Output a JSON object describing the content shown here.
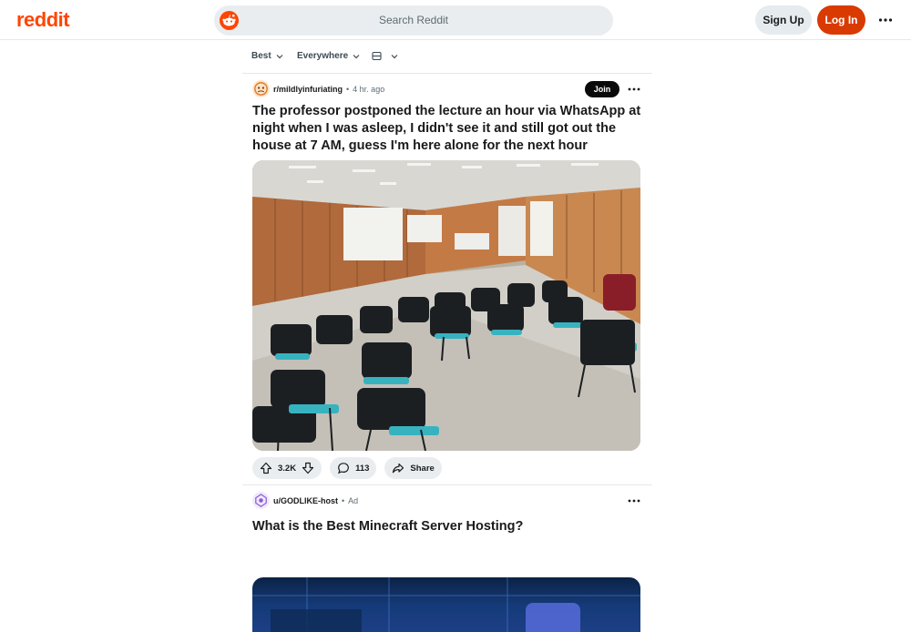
{
  "header": {
    "logo_text": "reddit",
    "search_placeholder": "Search Reddit",
    "signup_label": "Sign Up",
    "login_label": "Log In",
    "brand_color": "#ff4500",
    "login_color": "#d93a00"
  },
  "sortbar": {
    "sort": "Best",
    "location": "Everywhere",
    "view_icon": "layout-view-icon"
  },
  "posts": [
    {
      "subreddit": "r/mildlyinfuriating",
      "separator": "•",
      "time": "4 hr. ago",
      "join_label": "Join",
      "title": "The professor postponed the lecture an hour via WhatsApp at night when I was asleep, I didn't see it and still got out the house at 7 AM, guess I'm here alone for the next hour",
      "upvotes": "3.2K",
      "comments": "113",
      "share_label": "Share",
      "image": "empty-classroom-photo"
    },
    {
      "subreddit": "u/GODLIKE-host",
      "separator": "•",
      "time": "Ad",
      "title": "What is the Best Minecraft Server Hosting?",
      "image": "server-hosting-ad-image"
    }
  ]
}
